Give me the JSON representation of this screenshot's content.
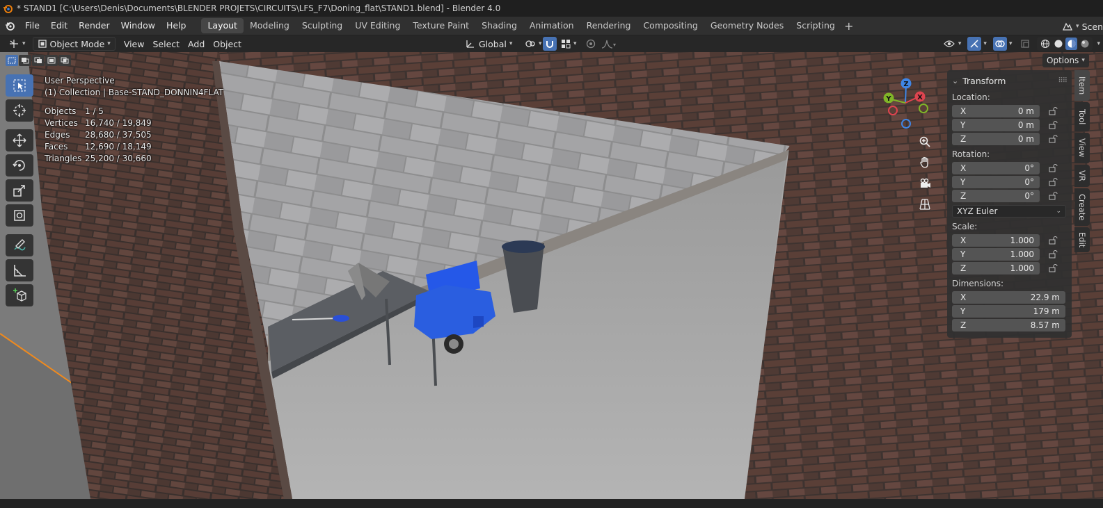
{
  "window": {
    "title": "* STAND1 [C:\\Users\\Denis\\Documents\\BLENDER PROJETS\\CIRCUITS\\LFS_F7\\Doning_flat\\STAND1.blend] - Blender 4.0"
  },
  "menubar": {
    "items": [
      "File",
      "Edit",
      "Render",
      "Window",
      "Help"
    ],
    "workspaces": [
      "Layout",
      "Modeling",
      "Sculpting",
      "UV Editing",
      "Texture Paint",
      "Shading",
      "Animation",
      "Rendering",
      "Compositing",
      "Geometry Nodes",
      "Scripting"
    ],
    "active_workspace": "Layout",
    "scene_label": "Scen"
  },
  "viewport_header": {
    "mode": "Object Mode",
    "menus": [
      "View",
      "Select",
      "Add",
      "Object"
    ],
    "transform_orientation": "Global",
    "options_label": "Options"
  },
  "overlay": {
    "perspective": "User Perspective",
    "collection": "(1) Collection | Base-STAND_DONNIN4FLAT",
    "stats": [
      {
        "label": "Objects",
        "value": "1 / 5"
      },
      {
        "label": "Vertices",
        "value": "16,740 / 19,849"
      },
      {
        "label": "Edges",
        "value": "28,680 / 37,505"
      },
      {
        "label": "Faces",
        "value": "12,690 / 18,149"
      },
      {
        "label": "Triangles",
        "value": "25,200 / 30,660"
      }
    ]
  },
  "gizmo": {
    "x": "X",
    "y": "Y",
    "z": "Z"
  },
  "npanel": {
    "header": "Transform",
    "location_label": "Location:",
    "location": [
      {
        "axis": "X",
        "value": "0 m"
      },
      {
        "axis": "Y",
        "value": "0 m"
      },
      {
        "axis": "Z",
        "value": "0 m"
      }
    ],
    "rotation_label": "Rotation:",
    "rotation": [
      {
        "axis": "X",
        "value": "0°"
      },
      {
        "axis": "Y",
        "value": "0°"
      },
      {
        "axis": "Z",
        "value": "0°"
      }
    ],
    "rotation_mode": "XYZ Euler",
    "scale_label": "Scale:",
    "scale": [
      {
        "axis": "X",
        "value": "1.000"
      },
      {
        "axis": "Y",
        "value": "1.000"
      },
      {
        "axis": "Z",
        "value": "1.000"
      }
    ],
    "dimensions_label": "Dimensions:",
    "dimensions": [
      {
        "axis": "X",
        "value": "22.9 m"
      },
      {
        "axis": "Y",
        "value": "179 m"
      },
      {
        "axis": "Z",
        "value": "8.57 m"
      }
    ]
  },
  "sidetabs": [
    "Item",
    "Tool",
    "View",
    "VR",
    "Create",
    "Edit"
  ],
  "colors": {
    "accent": "#4772b3",
    "axis_x": "#e0444f",
    "axis_y": "#80b528",
    "axis_z": "#3f86e6",
    "selection_outline": "#f08a1d"
  }
}
